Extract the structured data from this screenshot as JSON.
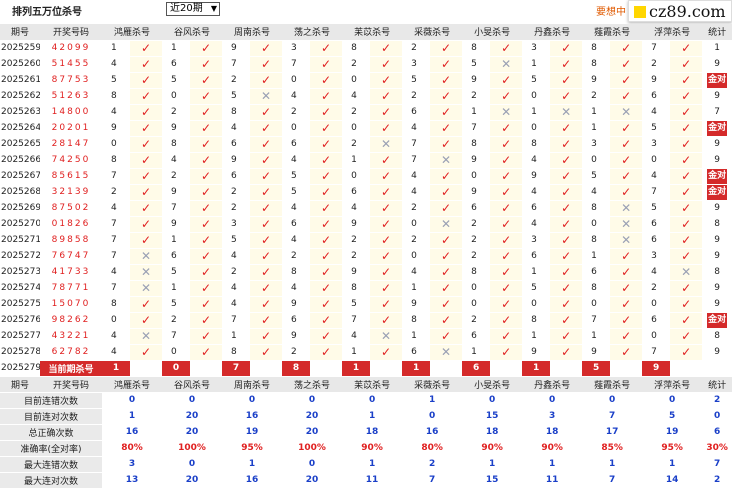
{
  "header": {
    "title": "排列五万位杀号",
    "period_select": "近20期",
    "ad_text": "要想中",
    "logo_text": "cz89.com"
  },
  "columns": [
    "期号",
    "开奖号码",
    "鸿雁杀号",
    "谷风杀号",
    "周南杀号",
    "荡之杀号",
    "苿苡杀号",
    "采薇杀号",
    "小旻杀号",
    "丹鑫杀号",
    "薤霞杀号",
    "浮萍杀号",
    "统计"
  ],
  "rows": [
    {
      "qh": "2025259",
      "kj": "42099",
      "s": [
        [
          "1",
          "ok"
        ],
        [
          "1",
          "ok"
        ],
        [
          "9",
          "ok"
        ],
        [
          "3",
          "ok"
        ],
        [
          "8",
          "ok"
        ],
        [
          "2",
          "ok"
        ],
        [
          "8",
          "ok"
        ],
        [
          "3",
          "ok"
        ],
        [
          "8",
          "ok"
        ],
        [
          "7",
          "ok"
        ]
      ],
      "tj": "1"
    },
    {
      "qh": "2025260",
      "kj": "51455",
      "s": [
        [
          "4",
          "ok"
        ],
        [
          "6",
          "ok"
        ],
        [
          "7",
          "ok"
        ],
        [
          "7",
          "ok"
        ],
        [
          "2",
          "ok"
        ],
        [
          "3",
          "ok"
        ],
        [
          "5",
          "no"
        ],
        [
          "1",
          "ok"
        ],
        [
          "8",
          "ok"
        ],
        [
          "2",
          "ok"
        ]
      ],
      "tj": "9"
    },
    {
      "qh": "2025261",
      "kj": "87753",
      "s": [
        [
          "5",
          "ok"
        ],
        [
          "5",
          "ok"
        ],
        [
          "2",
          "ok"
        ],
        [
          "0",
          "ok"
        ],
        [
          "0",
          "ok"
        ],
        [
          "5",
          "ok"
        ],
        [
          "9",
          "ok"
        ],
        [
          "5",
          "ok"
        ],
        [
          "9",
          "ok"
        ],
        [
          "9",
          "ok"
        ]
      ],
      "tj": "金对"
    },
    {
      "qh": "2025262",
      "kj": "51263",
      "s": [
        [
          "8",
          "ok"
        ],
        [
          "0",
          "ok"
        ],
        [
          "5",
          "no"
        ],
        [
          "4",
          "ok"
        ],
        [
          "4",
          "ok"
        ],
        [
          "2",
          "ok"
        ],
        [
          "2",
          "ok"
        ],
        [
          "0",
          "ok"
        ],
        [
          "2",
          "ok"
        ],
        [
          "6",
          "ok"
        ]
      ],
      "tj": "9"
    },
    {
      "qh": "2025263",
      "kj": "14800",
      "s": [
        [
          "4",
          "ok"
        ],
        [
          "2",
          "ok"
        ],
        [
          "8",
          "ok"
        ],
        [
          "2",
          "ok"
        ],
        [
          "2",
          "ok"
        ],
        [
          "6",
          "ok"
        ],
        [
          "1",
          "no"
        ],
        [
          "1",
          "no"
        ],
        [
          "1",
          "no"
        ],
        [
          "4",
          "ok"
        ]
      ],
      "tj": "7"
    },
    {
      "qh": "2025264",
      "kj": "20201",
      "s": [
        [
          "9",
          "ok"
        ],
        [
          "9",
          "ok"
        ],
        [
          "4",
          "ok"
        ],
        [
          "0",
          "ok"
        ],
        [
          "0",
          "ok"
        ],
        [
          "4",
          "ok"
        ],
        [
          "7",
          "ok"
        ],
        [
          "0",
          "ok"
        ],
        [
          "1",
          "ok"
        ],
        [
          "5",
          "ok"
        ]
      ],
      "tj": "金对"
    },
    {
      "qh": "2025265",
      "kj": "28147",
      "s": [
        [
          "0",
          "ok"
        ],
        [
          "8",
          "ok"
        ],
        [
          "6",
          "ok"
        ],
        [
          "6",
          "ok"
        ],
        [
          "2",
          "no"
        ],
        [
          "7",
          "ok"
        ],
        [
          "8",
          "ok"
        ],
        [
          "8",
          "ok"
        ],
        [
          "3",
          "ok"
        ],
        [
          "3",
          "ok"
        ]
      ],
      "tj": "9"
    },
    {
      "qh": "2025266",
      "kj": "74250",
      "s": [
        [
          "8",
          "ok"
        ],
        [
          "4",
          "ok"
        ],
        [
          "9",
          "ok"
        ],
        [
          "4",
          "ok"
        ],
        [
          "1",
          "ok"
        ],
        [
          "7",
          "no"
        ],
        [
          "9",
          "ok"
        ],
        [
          "4",
          "ok"
        ],
        [
          "0",
          "ok"
        ],
        [
          "0",
          "ok"
        ]
      ],
      "tj": "9"
    },
    {
      "qh": "2025267",
      "kj": "85615",
      "s": [
        [
          "7",
          "ok"
        ],
        [
          "2",
          "ok"
        ],
        [
          "6",
          "ok"
        ],
        [
          "5",
          "ok"
        ],
        [
          "0",
          "ok"
        ],
        [
          "4",
          "ok"
        ],
        [
          "0",
          "ok"
        ],
        [
          "9",
          "ok"
        ],
        [
          "5",
          "ok"
        ],
        [
          "4",
          "ok"
        ]
      ],
      "tj": "金对"
    },
    {
      "qh": "2025268",
      "kj": "32139",
      "s": [
        [
          "2",
          "ok"
        ],
        [
          "9",
          "ok"
        ],
        [
          "2",
          "ok"
        ],
        [
          "5",
          "ok"
        ],
        [
          "6",
          "ok"
        ],
        [
          "4",
          "ok"
        ],
        [
          "9",
          "ok"
        ],
        [
          "4",
          "ok"
        ],
        [
          "4",
          "ok"
        ],
        [
          "7",
          "ok"
        ]
      ],
      "tj": "金对"
    },
    {
      "qh": "2025269",
      "kj": "87502",
      "s": [
        [
          "4",
          "ok"
        ],
        [
          "7",
          "ok"
        ],
        [
          "2",
          "ok"
        ],
        [
          "4",
          "ok"
        ],
        [
          "4",
          "ok"
        ],
        [
          "2",
          "ok"
        ],
        [
          "6",
          "ok"
        ],
        [
          "6",
          "ok"
        ],
        [
          "8",
          "no"
        ],
        [
          "5",
          "ok"
        ]
      ],
      "tj": "9"
    },
    {
      "qh": "2025270",
      "kj": "01826",
      "s": [
        [
          "7",
          "ok"
        ],
        [
          "9",
          "ok"
        ],
        [
          "3",
          "ok"
        ],
        [
          "6",
          "ok"
        ],
        [
          "9",
          "ok"
        ],
        [
          "0",
          "no"
        ],
        [
          "2",
          "ok"
        ],
        [
          "4",
          "ok"
        ],
        [
          "0",
          "no"
        ],
        [
          "6",
          "ok"
        ]
      ],
      "tj": "8"
    },
    {
      "qh": "2025271",
      "kj": "89858",
      "s": [
        [
          "7",
          "ok"
        ],
        [
          "1",
          "ok"
        ],
        [
          "5",
          "ok"
        ],
        [
          "4",
          "ok"
        ],
        [
          "2",
          "ok"
        ],
        [
          "2",
          "ok"
        ],
        [
          "2",
          "ok"
        ],
        [
          "3",
          "ok"
        ],
        [
          "8",
          "no"
        ],
        [
          "6",
          "ok"
        ]
      ],
      "tj": "9"
    },
    {
      "qh": "2025272",
      "kj": "76747",
      "s": [
        [
          "7",
          "no"
        ],
        [
          "6",
          "ok"
        ],
        [
          "4",
          "ok"
        ],
        [
          "2",
          "ok"
        ],
        [
          "2",
          "ok"
        ],
        [
          "0",
          "ok"
        ],
        [
          "2",
          "ok"
        ],
        [
          "6",
          "ok"
        ],
        [
          "1",
          "ok"
        ],
        [
          "3",
          "ok"
        ]
      ],
      "tj": "9"
    },
    {
      "qh": "2025273",
      "kj": "41733",
      "s": [
        [
          "4",
          "no"
        ],
        [
          "5",
          "ok"
        ],
        [
          "2",
          "ok"
        ],
        [
          "8",
          "ok"
        ],
        [
          "9",
          "ok"
        ],
        [
          "4",
          "ok"
        ],
        [
          "8",
          "ok"
        ],
        [
          "1",
          "ok"
        ],
        [
          "6",
          "ok"
        ],
        [
          "4",
          "no"
        ]
      ],
      "tj": "8"
    },
    {
      "qh": "2025274",
      "kj": "78771",
      "s": [
        [
          "7",
          "no"
        ],
        [
          "1",
          "ok"
        ],
        [
          "4",
          "ok"
        ],
        [
          "4",
          "ok"
        ],
        [
          "8",
          "ok"
        ],
        [
          "1",
          "ok"
        ],
        [
          "0",
          "ok"
        ],
        [
          "5",
          "ok"
        ],
        [
          "8",
          "ok"
        ],
        [
          "2",
          "ok"
        ]
      ],
      "tj": "9"
    },
    {
      "qh": "2025275",
      "kj": "15070",
      "s": [
        [
          "8",
          "ok"
        ],
        [
          "5",
          "ok"
        ],
        [
          "4",
          "ok"
        ],
        [
          "9",
          "ok"
        ],
        [
          "5",
          "ok"
        ],
        [
          "9",
          "ok"
        ],
        [
          "0",
          "ok"
        ],
        [
          "0",
          "ok"
        ],
        [
          "0",
          "ok"
        ],
        [
          "0",
          "ok"
        ]
      ],
      "tj": "9"
    },
    {
      "qh": "2025276",
      "kj": "98262",
      "s": [
        [
          "0",
          "ok"
        ],
        [
          "2",
          "ok"
        ],
        [
          "7",
          "ok"
        ],
        [
          "6",
          "ok"
        ],
        [
          "7",
          "ok"
        ],
        [
          "8",
          "ok"
        ],
        [
          "2",
          "ok"
        ],
        [
          "8",
          "ok"
        ],
        [
          "7",
          "ok"
        ],
        [
          "6",
          "ok"
        ]
      ],
      "tj": "金对"
    },
    {
      "qh": "2025277",
      "kj": "43221",
      "s": [
        [
          "4",
          "no"
        ],
        [
          "7",
          "ok"
        ],
        [
          "1",
          "ok"
        ],
        [
          "9",
          "ok"
        ],
        [
          "4",
          "no"
        ],
        [
          "1",
          "ok"
        ],
        [
          "6",
          "ok"
        ],
        [
          "1",
          "ok"
        ],
        [
          "1",
          "ok"
        ],
        [
          "0",
          "ok"
        ]
      ],
      "tj": "8"
    },
    {
      "qh": "2025278",
      "kj": "62782",
      "s": [
        [
          "4",
          "ok"
        ],
        [
          "0",
          "ok"
        ],
        [
          "8",
          "ok"
        ],
        [
          "2",
          "ok"
        ],
        [
          "1",
          "ok"
        ],
        [
          "6",
          "no"
        ],
        [
          "1",
          "ok"
        ],
        [
          "9",
          "ok"
        ],
        [
          "9",
          "ok"
        ],
        [
          "7",
          "ok"
        ]
      ],
      "tj": "9"
    }
  ],
  "current": {
    "qh": "2025279",
    "label": "当前期杀号",
    "kills": [
      "1",
      "0",
      "7",
      "8",
      "1",
      "1",
      "6",
      "1",
      "5",
      "9"
    ]
  },
  "stats": [
    {
      "label": "目前连错次数",
      "vals": [
        "0",
        "0",
        "0",
        "0",
        "0",
        "1",
        "0",
        "0",
        "0",
        "0"
      ],
      "tj": "2"
    },
    {
      "label": "目前连对次数",
      "vals": [
        "1",
        "20",
        "16",
        "20",
        "1",
        "0",
        "15",
        "3",
        "7",
        "5"
      ],
      "tj": "0"
    },
    {
      "label": "总正确次数",
      "vals": [
        "16",
        "20",
        "19",
        "20",
        "18",
        "16",
        "18",
        "18",
        "17",
        "19"
      ],
      "tj": "6"
    },
    {
      "label": "准确率(全对率)",
      "vals": [
        "80%",
        "100%",
        "95%",
        "100%",
        "90%",
        "80%",
        "90%",
        "90%",
        "85%",
        "95%"
      ],
      "tj": "30%",
      "red": true
    },
    {
      "label": "最大连错次数",
      "vals": [
        "3",
        "0",
        "1",
        "0",
        "1",
        "2",
        "1",
        "1",
        "1",
        "1"
      ],
      "tj": "7"
    },
    {
      "label": "最大连对次数",
      "vals": [
        "13",
        "20",
        "16",
        "20",
        "11",
        "7",
        "15",
        "11",
        "7",
        "14"
      ],
      "tj": "2"
    }
  ]
}
